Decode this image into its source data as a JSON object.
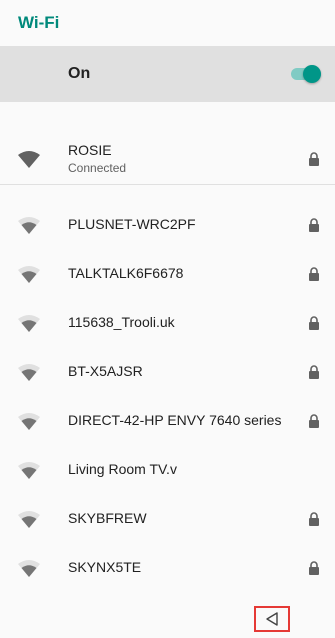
{
  "header": {
    "title": "Wi-Fi"
  },
  "master": {
    "label": "On",
    "enabled": true
  },
  "colors": {
    "accent": "#009688",
    "title": "#00897b",
    "highlight": "#e53935"
  },
  "connected": {
    "ssid": "ROSIE",
    "status": "Connected",
    "secured": true
  },
  "networks": [
    {
      "ssid": "PLUSNET-WRC2PF",
      "secured": true
    },
    {
      "ssid": "TALKTALK6F6678",
      "secured": true
    },
    {
      "ssid": "115638_Trooli.uk",
      "secured": true
    },
    {
      "ssid": "BT-X5AJSR",
      "secured": true
    },
    {
      "ssid": "DIRECT-42-HP ENVY 7640 series",
      "secured": true
    },
    {
      "ssid": "Living Room TV.v",
      "secured": false
    },
    {
      "ssid": "SKYBFREW",
      "secured": true
    },
    {
      "ssid": "SKYNX5TE",
      "secured": true
    }
  ],
  "icons": {
    "signal": "wifi-signal-icon",
    "lock": "lock-icon",
    "back": "back-triangle-icon"
  }
}
